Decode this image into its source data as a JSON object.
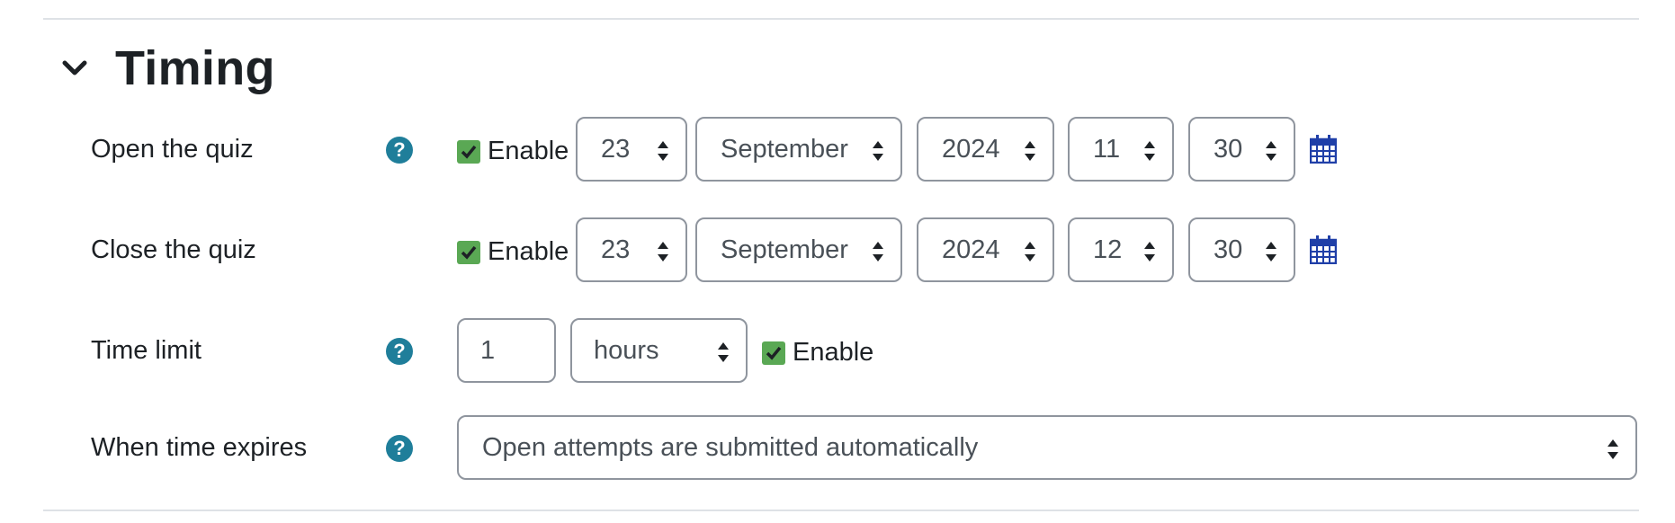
{
  "section": {
    "title": "Timing",
    "expanded": true
  },
  "rows": {
    "open": {
      "label": "Open the quiz",
      "enable_label": "Enable",
      "enabled": true,
      "day": "23",
      "month": "September",
      "year": "2024",
      "hour": "11",
      "minute": "30"
    },
    "close": {
      "label": "Close the quiz",
      "enable_label": "Enable",
      "enabled": true,
      "day": "23",
      "month": "September",
      "year": "2024",
      "hour": "12",
      "minute": "30"
    },
    "timelimit": {
      "label": "Time limit",
      "value": "1",
      "unit": "hours",
      "enable_label": "Enable",
      "enabled": true
    },
    "expires": {
      "label": "When time expires",
      "value": "Open attempts are submitted automatically"
    }
  },
  "help_glyph": "?",
  "colors": {
    "help": "#1f7e9a",
    "checkbox": "#5aa854",
    "calendar": "#1f3fa8"
  },
  "icons": [
    "chevron-down-icon",
    "help-icon",
    "checkbox-checked-icon",
    "select-arrow-icon",
    "calendar-icon"
  ]
}
